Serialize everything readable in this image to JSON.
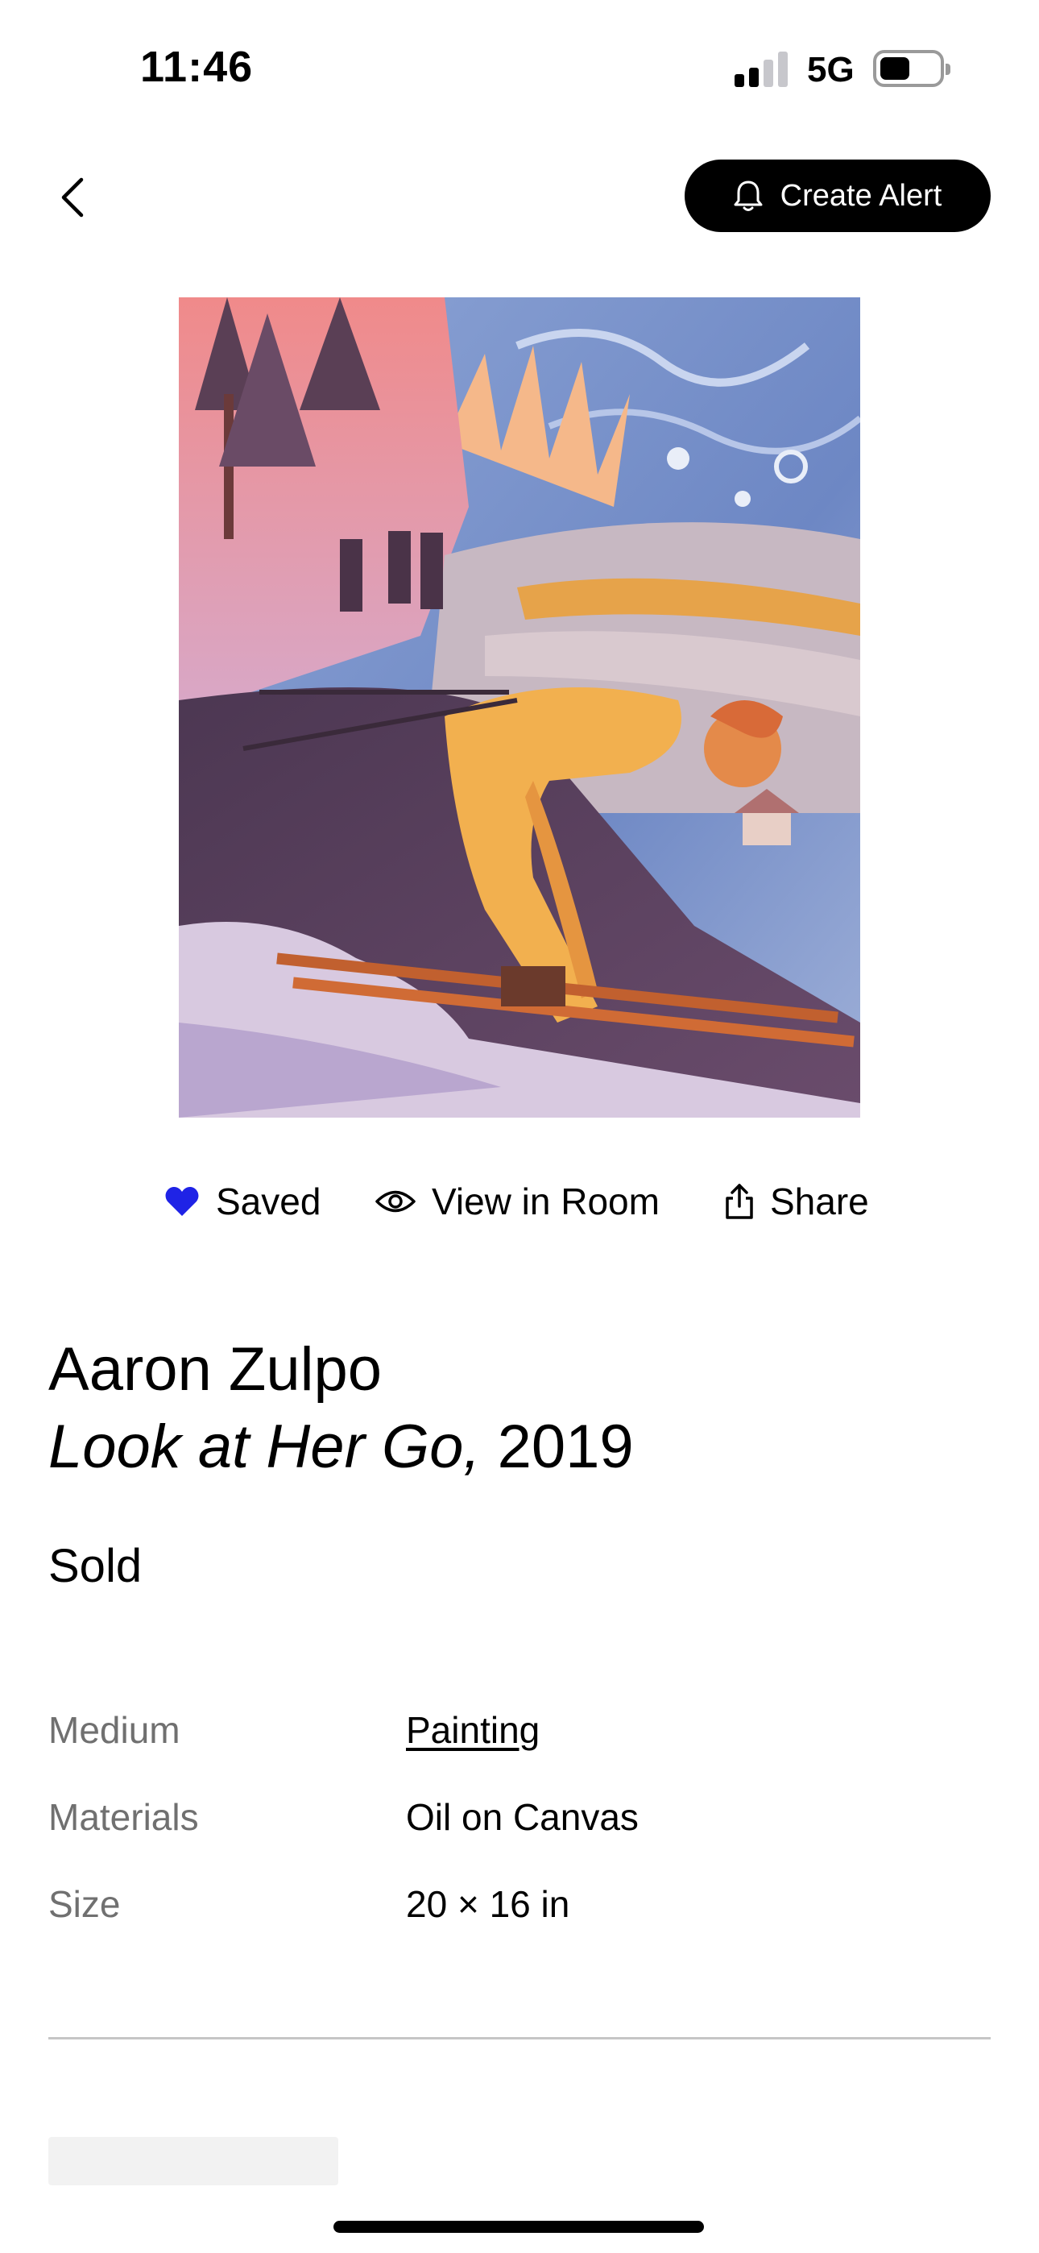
{
  "status_bar": {
    "time": "11:46",
    "network": "5G",
    "signal_bars_active": 2,
    "signal_bars_total": 4
  },
  "nav": {
    "back_icon": "chevron-left-icon",
    "alert_button": {
      "label": "Create Alert",
      "icon": "bell-icon"
    }
  },
  "artwork_image": {
    "description_icon": "painting-image"
  },
  "actions": {
    "saved": {
      "label": "Saved",
      "icon": "heart-filled-icon",
      "color": "#1f23e6"
    },
    "view_in_room": {
      "label": "View in Room",
      "icon": "eye-icon"
    },
    "share": {
      "label": "Share",
      "icon": "share-icon"
    }
  },
  "artwork": {
    "artist": "Aaron Zulpo",
    "title": "Look at Her Go,",
    "year": "2019",
    "availability": "Sold"
  },
  "details": [
    {
      "label": "Medium",
      "value": "Painting",
      "link": true
    },
    {
      "label": "Materials",
      "value": "Oil on Canvas",
      "link": false
    },
    {
      "label": "Size",
      "value": "20 × 16 in",
      "link": false
    }
  ]
}
